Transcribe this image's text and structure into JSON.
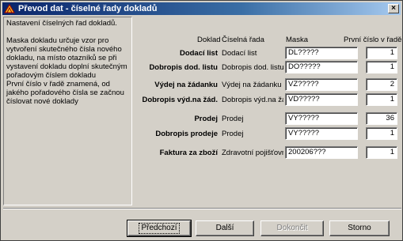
{
  "window": {
    "title": "Převod dat - číselné řady dokladů"
  },
  "info": {
    "heading": "Nastavení číselných řad dokladů.",
    "para1": "Maska dokladu určuje vzor pro vytvoření skutečného čísla nového dokladu, na místo otazníků se při vystavení dokladu doplní skutečným pořadovým číslem dokladu",
    "para2": "První číslo v řadě znamená, od jakého pořadového čísla se začnou číslovat nové doklady"
  },
  "columns": {
    "doklad": "Doklad",
    "rada": "Číselná řada",
    "maska": "Maska",
    "prvni": "První číslo v řadě"
  },
  "rows": [
    {
      "doklad": "Dodací list",
      "rada": "Dodací list",
      "maska": "DL?????",
      "prvni": "1"
    },
    {
      "doklad": "Dobropis dod. listu",
      "rada": "Dobropis dod. listu",
      "maska": "DO?????",
      "prvni": "1"
    },
    {
      "doklad": "Výdej na žádanku",
      "rada": "Výdej na žádanku",
      "maska": "VZ?????",
      "prvni": "2"
    },
    {
      "doklad": "Dobropis výd.na žád.",
      "rada": "Dobropis výd.na žác",
      "maska": "VD?????",
      "prvni": "1"
    },
    {
      "doklad": "Prodej",
      "rada": "Prodej",
      "maska": "VY?????",
      "prvni": "36"
    },
    {
      "doklad": "Dobropis prodeje",
      "rada": "Prodej",
      "maska": "VY?????",
      "prvni": "1"
    },
    {
      "doklad": "Faktura za zboží",
      "rada": "Zdravotní pojišťovna",
      "maska": "200206???",
      "prvni": "1"
    }
  ],
  "buttons": {
    "prev": "Předchozí",
    "next": "Další",
    "finish": "Dokončit",
    "cancel": "Storno"
  },
  "icons": {
    "app": "app-logo-icon",
    "close": "close-icon"
  }
}
